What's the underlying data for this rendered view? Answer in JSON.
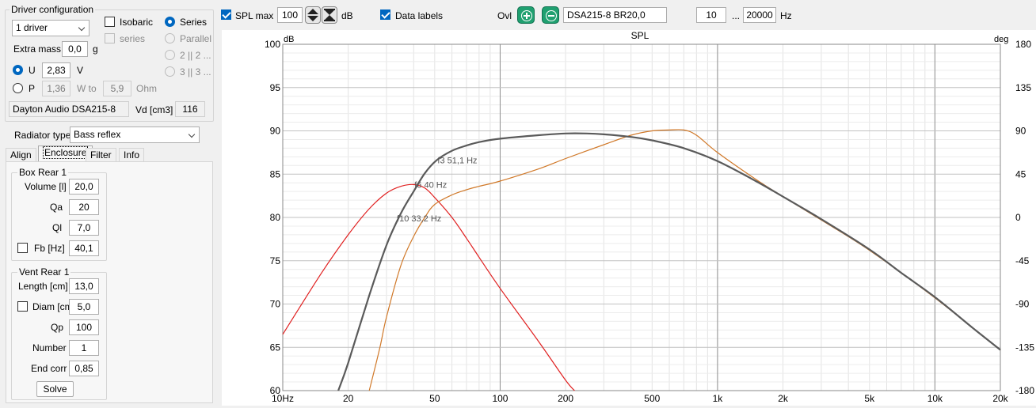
{
  "driver_config": {
    "title": "Driver configuration",
    "driver_count": "1 driver",
    "isobaric_label": "Isobaric",
    "isobaric_checked": false,
    "series_sub_label": "series",
    "series_label": "Series",
    "parallel_label": "Parallel",
    "option_2": "2 || 2 ...",
    "option_3": "3 || 3 ...",
    "extra_mass_label": "Extra mass",
    "extra_mass_value": "0,0",
    "extra_mass_unit": "g",
    "u_label": "U",
    "u_value": "2,83",
    "u_unit": "V",
    "p_label": "P",
    "p_value": "1,36",
    "w_to_label": "W to",
    "w_to_value": "5,9",
    "ohm_label": "Ohm",
    "driver_name": "Dayton Audio DSA215-8",
    "vd_label": "Vd [cm3]",
    "vd_value": "116"
  },
  "radiator": {
    "label": "Radiator type",
    "value": "Bass reflex"
  },
  "tabs": [
    {
      "label": "Align",
      "active": false
    },
    {
      "label": "Enclosure",
      "active": true
    },
    {
      "label": "Filter",
      "active": false
    },
    {
      "label": "Info",
      "active": false
    }
  ],
  "box_rear": {
    "title": "Box Rear 1",
    "volume_label": "Volume [l]",
    "volume_value": "20,0",
    "qa_label": "Qa",
    "qa_value": "20",
    "ql_label": "Ql",
    "ql_value": "7,0",
    "fb_label": "Fb [Hz]",
    "fb_value": "40,1",
    "fb_checked": false
  },
  "vent_rear": {
    "title": "Vent Rear 1",
    "length_label": "Length [cm]",
    "length_value": "13,0",
    "diam_label": "Diam [cm]",
    "diam_value": "5,0",
    "diam_checked": false,
    "qp_label": "Qp",
    "qp_value": "100",
    "number_label": "Number",
    "number_value": "1",
    "endcorr_label": "End corr",
    "endcorr_value": "0,85",
    "solve_label": "Solve"
  },
  "toolbar": {
    "spl_max_label": "SPL max",
    "spl_max_checked": true,
    "spl_max_value": "100",
    "db_unit": "dB",
    "data_labels_label": "Data labels",
    "data_labels_checked": true,
    "ovl_label": "Ovl",
    "overlay_name": "DSA215-8 BR20,0",
    "freq_min": "10",
    "freq_sep": "...",
    "freq_max": "20000",
    "freq_unit": "Hz"
  },
  "colors": {
    "accent": "#0067c0",
    "total_curve": "#5a5a5a",
    "port_curve": "#e02020",
    "driver_curve": "#d07828",
    "button_green": "#20a070"
  },
  "chart_data": {
    "type": "line",
    "title": "SPL",
    "ylabel_left": "dB",
    "ylabel_right": "deg",
    "xscale": "log",
    "xlim": [
      10,
      20000
    ],
    "ylim": [
      60,
      100
    ],
    "y2lim": [
      -180,
      180
    ],
    "x_ticks": [
      "10Hz",
      "20",
      "50",
      "100",
      "200",
      "500",
      "1k",
      "2k",
      "5k",
      "10k",
      "20k"
    ],
    "x_tick_values": [
      10,
      20,
      50,
      100,
      200,
      500,
      1000,
      2000,
      5000,
      10000,
      20000
    ],
    "y_ticks": [
      "100",
      "95",
      "90",
      "85",
      "80",
      "75",
      "70",
      "65",
      "60"
    ],
    "y_tick_values": [
      100,
      95,
      90,
      85,
      80,
      75,
      70,
      65,
      60
    ],
    "y2_ticks": [
      "180",
      "135",
      "90",
      "45",
      "0",
      "-45",
      "-90",
      "-135",
      "-180"
    ],
    "y2_tick_values": [
      180,
      135,
      90,
      45,
      0,
      -45,
      -90,
      -135,
      -180
    ],
    "grid": true,
    "series": [
      {
        "key": "total",
        "x": [
          18,
          20,
          25,
          30,
          35,
          40,
          45,
          51,
          60,
          70,
          80,
          100,
          150,
          200,
          250,
          300,
          400,
          500,
          700,
          1000,
          1500,
          2000,
          3000,
          5000,
          7000,
          10000,
          15000,
          20000
        ],
        "y": [
          60,
          63.2,
          71,
          76.8,
          80.5,
          83,
          85.1,
          86.6,
          87.7,
          88.3,
          88.7,
          89.1,
          89.5,
          89.7,
          89.7,
          89.6,
          89.3,
          88.9,
          88,
          86.5,
          84.2,
          82.4,
          79.8,
          76.3,
          73.6,
          70.8,
          67.2,
          64.7
        ]
      },
      {
        "key": "port",
        "x": [
          10,
          15,
          20,
          25,
          30,
          35,
          40,
          45,
          50,
          60,
          70,
          80,
          100,
          150,
          200,
          220
        ],
        "y": [
          66.5,
          73.5,
          78,
          81,
          82.8,
          83.6,
          83.8,
          83.4,
          82.3,
          80,
          77.6,
          75.4,
          71.8,
          65.7,
          61.2,
          60
        ]
      },
      {
        "key": "driver",
        "x": [
          25,
          28,
          30,
          35,
          40,
          45,
          50,
          60,
          70,
          80,
          100,
          150,
          200,
          300,
          400,
          500,
          600,
          700,
          800,
          1000,
          1500,
          2000,
          3000,
          5000,
          10000,
          20000
        ],
        "y": [
          60,
          65,
          68.5,
          74.5,
          77.8,
          80,
          81.5,
          82.6,
          83.2,
          83.6,
          84.2,
          85.6,
          86.8,
          88.4,
          89.5,
          90,
          90.1,
          90.1,
          89.5,
          87.5,
          84.4,
          82.4,
          79.7,
          76.2,
          70.7,
          64.7
        ]
      }
    ],
    "annotations": [
      {
        "text": "f3 51,1 Hz",
        "x": 51.1,
        "y": 86.6
      },
      {
        "text": "f6 40 Hz",
        "x": 40,
        "y": 83.8
      },
      {
        "text": "f10 33,2 Hz",
        "x": 33.2,
        "y": 79.9
      }
    ]
  }
}
